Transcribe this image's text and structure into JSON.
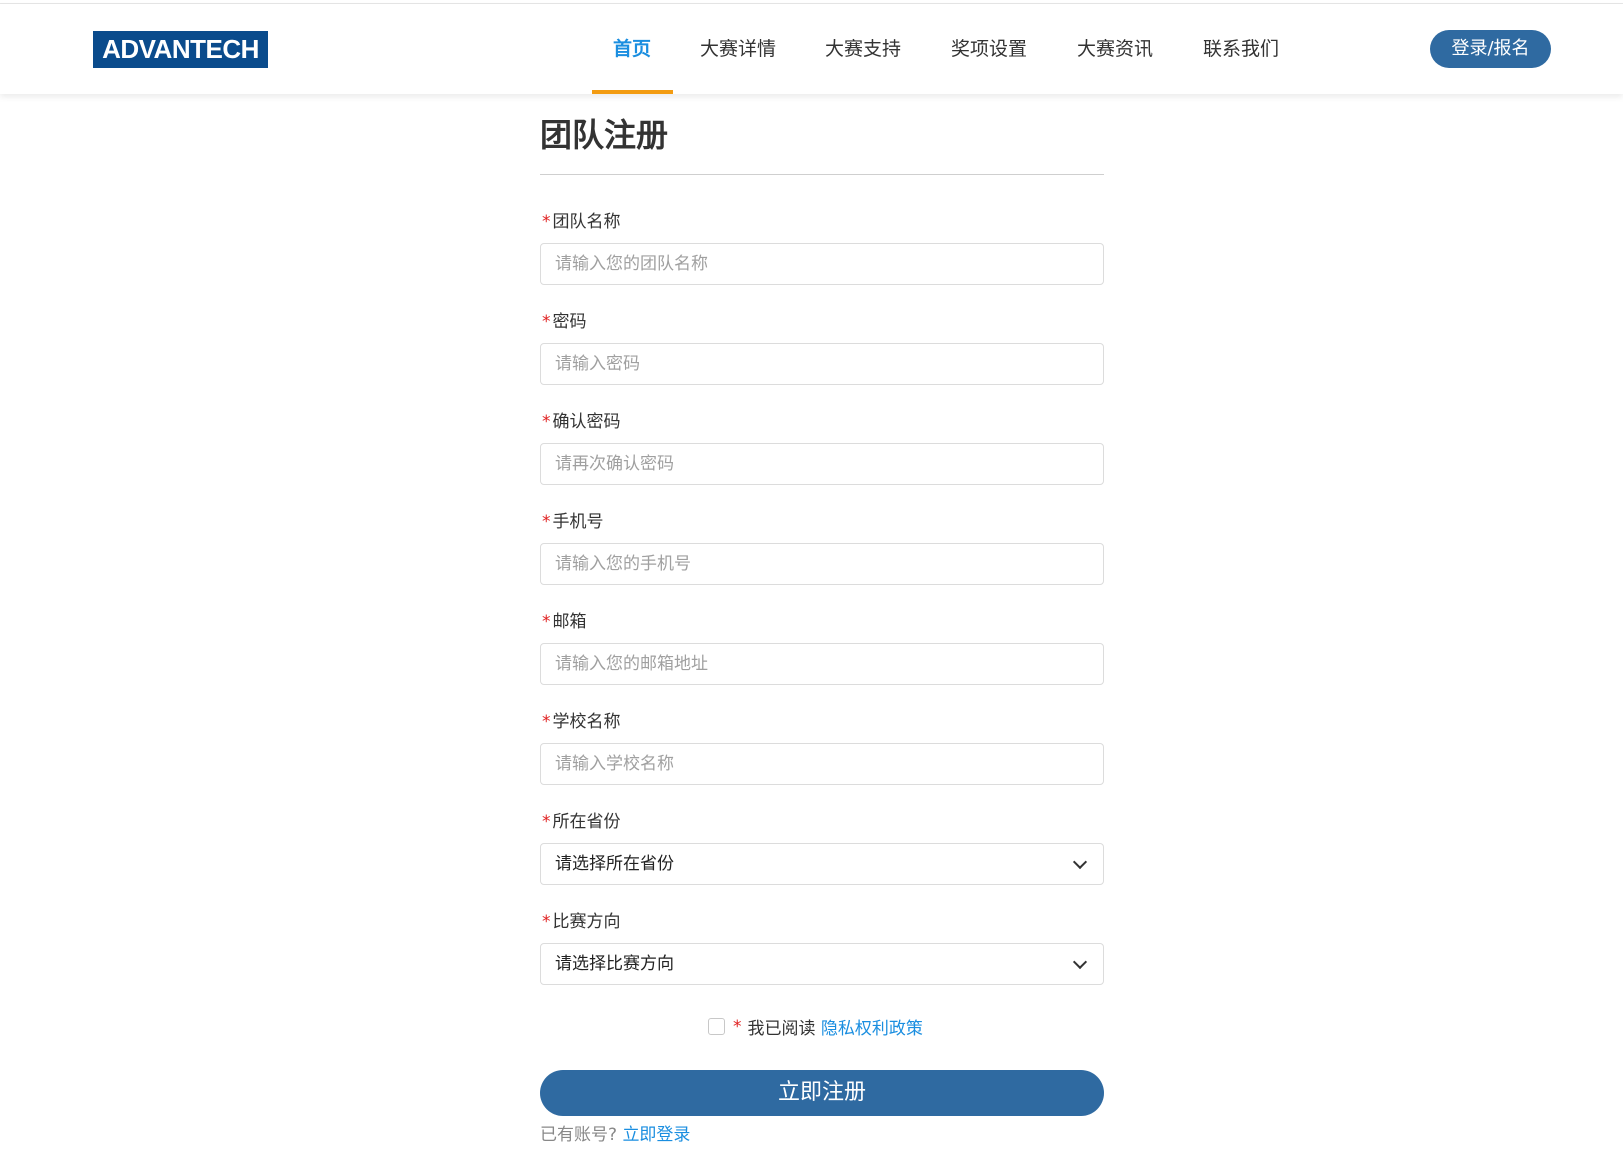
{
  "header": {
    "logo_text": "ADVANTECH",
    "nav": [
      {
        "label": "首页",
        "active": true
      },
      {
        "label": "大赛详情",
        "active": false
      },
      {
        "label": "大赛支持",
        "active": false
      },
      {
        "label": "奖项设置",
        "active": false
      },
      {
        "label": "大赛资讯",
        "active": false
      },
      {
        "label": "联系我们",
        "active": false
      }
    ],
    "login_button": "登录/报名",
    "colors": {
      "active_nav": "#1a8ee0",
      "underline": "#f39c12",
      "brand": "#0a4b8c",
      "button": "#2f6aa1"
    }
  },
  "form": {
    "title": "团队注册",
    "required_mark": "*",
    "fields": [
      {
        "label": "团队名称",
        "placeholder": "请输入您的团队名称",
        "type": "input"
      },
      {
        "label": "密码",
        "placeholder": "请输入密码",
        "type": "password"
      },
      {
        "label": "确认密码",
        "placeholder": "请再次确认密码",
        "type": "password"
      },
      {
        "label": "手机号",
        "placeholder": "请输入您的手机号",
        "type": "input"
      },
      {
        "label": "邮箱",
        "placeholder": "请输入您的邮箱地址",
        "type": "input"
      },
      {
        "label": "学校名称",
        "placeholder": "请输入学校名称",
        "type": "input"
      },
      {
        "label": "所在省份",
        "selected": "请选择所在省份",
        "type": "select"
      },
      {
        "label": "比赛方向",
        "selected": "请选择比赛方向",
        "type": "select"
      }
    ],
    "agree_text": "我已阅读",
    "agree_link": "隐私权利政策",
    "submit_label": "立即注册",
    "login_hint": "已有账号?",
    "login_link": "立即登录"
  }
}
